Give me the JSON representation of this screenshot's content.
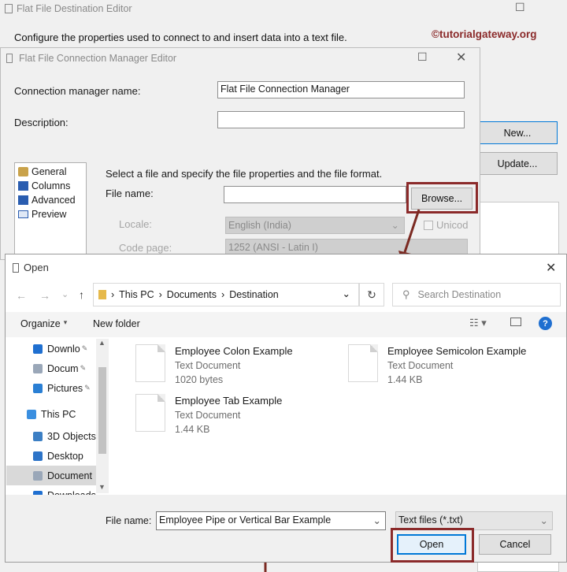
{
  "flat_file_dest": {
    "title": "Flat File Destination Editor",
    "description": "Configure the properties used to connect to and insert data into a text file.",
    "watermark": "©tutorialgateway.org",
    "new_label": "New...",
    "update_label": "Update..."
  },
  "conn_mgr": {
    "title": "Flat File Connection Manager Editor",
    "name_label": "Connection manager name:",
    "name_value": "Flat File Connection Manager",
    "desc_label": "Description:",
    "nav": [
      "General",
      "Columns",
      "Advanced",
      "Preview"
    ],
    "instruction": "Select a file and specify the file properties and the file format.",
    "file_name_label": "File name:",
    "browse_label": "Browse...",
    "locale_label": "Locale:",
    "locale_value": "English (India)",
    "unicode_label": "Unicod",
    "codepage_label": "Code page:",
    "codepage_value": "1252  (ANSI - Latin I)"
  },
  "open_dialog": {
    "title": "Open",
    "breadcrumb": [
      "This PC",
      "Documents",
      "Destination"
    ],
    "search_placeholder": "Search Destination",
    "organize_label": "Organize",
    "new_folder_label": "New folder",
    "nav_items": [
      {
        "label": "Downlo",
        "icon": "download-icon",
        "pinned": true
      },
      {
        "label": "Docum",
        "icon": "document-icon",
        "pinned": true
      },
      {
        "label": "Pictures",
        "icon": "pictures-icon",
        "pinned": true
      },
      {
        "label": "This PC",
        "icon": "computer-icon",
        "pinned": false
      },
      {
        "label": "3D Objects",
        "icon": "cube-icon",
        "pinned": false
      },
      {
        "label": "Desktop",
        "icon": "desktop-icon",
        "pinned": false
      },
      {
        "label": "Document",
        "icon": "document-icon",
        "pinned": false
      },
      {
        "label": "Downloads",
        "icon": "download-icon",
        "pinned": false
      }
    ],
    "files": [
      {
        "name": "Employee Colon Example",
        "type": "Text Document",
        "size": "1020 bytes"
      },
      {
        "name": "Employee Semicolon Example",
        "type": "Text Document",
        "size": "1.44 KB"
      },
      {
        "name": "Employee Tab Example",
        "type": "Text Document",
        "size": "1.44 KB"
      }
    ],
    "file_name_label": "File name:",
    "file_name_value": "Employee Pipe or Vertical Bar Example",
    "file_type_value": "Text files (*.txt)",
    "open_label": "Open",
    "cancel_label": "Cancel"
  },
  "colors": {
    "accent": "#0078d7",
    "highlight_box": "#8b2a2a"
  }
}
